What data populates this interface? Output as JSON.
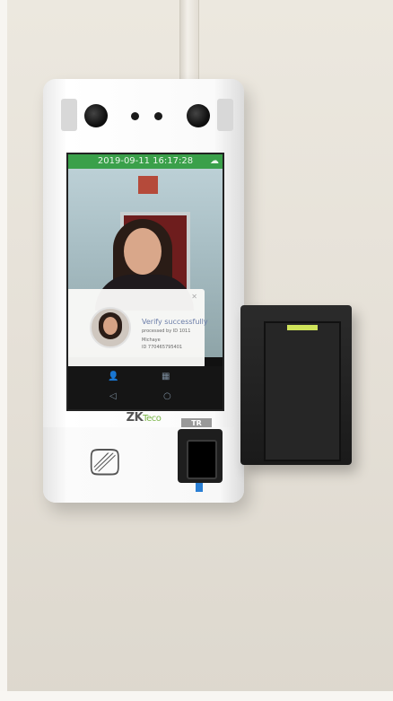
{
  "screen": {
    "status_bar": {
      "timestamp": "2019-09-11 16:17:28"
    },
    "notification": {
      "title": "Verify successfully",
      "subtitle": "processed by ID 1011",
      "name": "Michaye",
      "id_line": "ID 770465795401"
    }
  },
  "device": {
    "brand_main": "ZK",
    "brand_eco": "Teco",
    "reader_logo": "TR"
  },
  "colors": {
    "status_bar": "#3aa04a",
    "fingerprint_led": "#2a7fd4",
    "reader_led": "#cfe35a"
  }
}
